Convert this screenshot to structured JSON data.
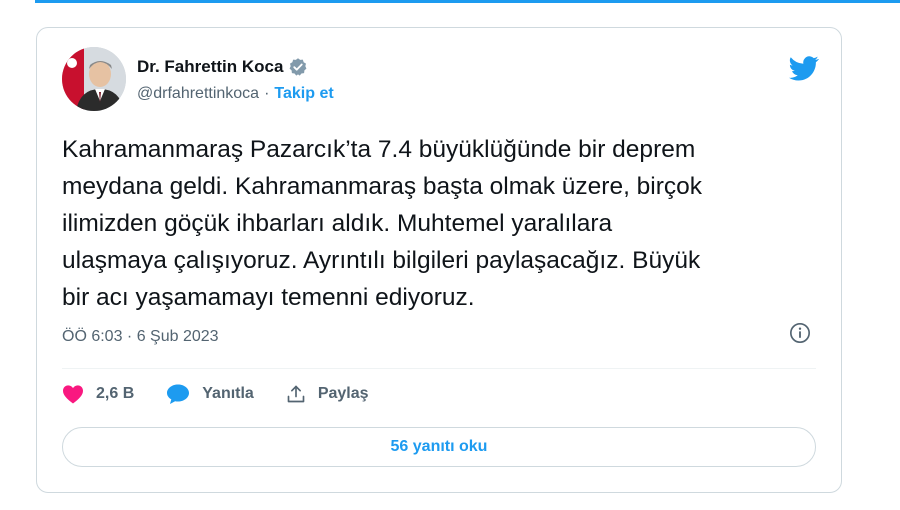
{
  "colors": {
    "accent": "#1d9bf0",
    "like": "#f91880",
    "secondary_text": "#536471",
    "text": "#0f1419"
  },
  "author": {
    "name": "Dr. Fahrettin Koca",
    "handle": "@drfahrettinkoca",
    "separator": "·",
    "follow_label": "Takip et",
    "verified_icon": "verified-badge-icon"
  },
  "tweet": {
    "text": "Kahramanmaraş Pazarcık’ta 7.4 büyüklüğünde bir deprem\nmeydana geldi. Kahramanmaraş başta olmak üzere, birçok\nilimizden göçük ihbarları aldık. Muhtemel yaralılara\nulaşmaya çalışıyoruz. Ayrıntılı bilgileri paylaşacağız. Büyük\nbir acı yaşamamayı temenni ediyoruz.",
    "timestamp": "ÖÖ 6:03 · 6 Şub 2023"
  },
  "actions": {
    "likes": "2,6 B",
    "reply_label": "Yanıtla",
    "share_label": "Paylaş"
  },
  "replies_button": "56 yanıtı oku",
  "icons": [
    "twitter-bird-icon",
    "info-icon",
    "heart-icon",
    "reply-bubble-icon",
    "share-icon"
  ]
}
